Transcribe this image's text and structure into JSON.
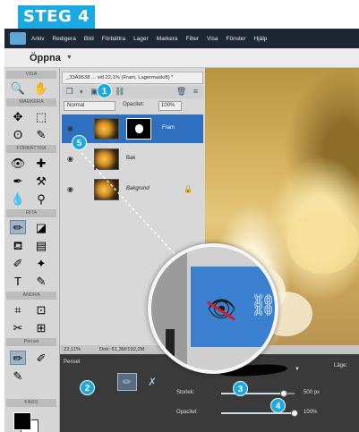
{
  "step_label": "STEG 4",
  "menu": {
    "items": [
      "Arkiv",
      "Redigera",
      "Bild",
      "Förbättra",
      "Lager",
      "Markera",
      "Filter",
      "Visa",
      "Fönster",
      "Hjälp"
    ]
  },
  "open_bar": {
    "label": "Öppna"
  },
  "toolbox": {
    "sections": [
      "VISA",
      "MARKERA",
      "FÖRBÄTTRA",
      "RITA",
      "ÄNDRA",
      "FÄRG"
    ]
  },
  "document": {
    "tab_title": "_33A9638 ... vid 22,1% (Fram, Lagermask/8) *",
    "blend_mode": "Normal",
    "opacity_label": "Opacitet:",
    "opacity_value": "100%",
    "layers": [
      {
        "name": "Fram",
        "selected": true
      },
      {
        "name": "Bak",
        "selected": false
      },
      {
        "name": "Bakgrund",
        "selected": false
      }
    ]
  },
  "status": {
    "zoom": "22,11%",
    "doc": "Dok: 61,3M/192,2M"
  },
  "options": {
    "tool_name": "Pensel",
    "brush_label": "Pensel:",
    "mode_label": "Läge:",
    "size_label": "Storlek:",
    "size_value": "500 px",
    "size_fraction": 0.85,
    "opacity_label": "Opacitet:",
    "opacity_value": "100%",
    "opacity_fraction": 1.0
  },
  "callouts": [
    "1",
    "2",
    "3",
    "4",
    "5"
  ],
  "colors": {
    "accent": "#1aa9e0",
    "menubar": "#1c2634",
    "selected_layer": "#2f6fc0"
  }
}
